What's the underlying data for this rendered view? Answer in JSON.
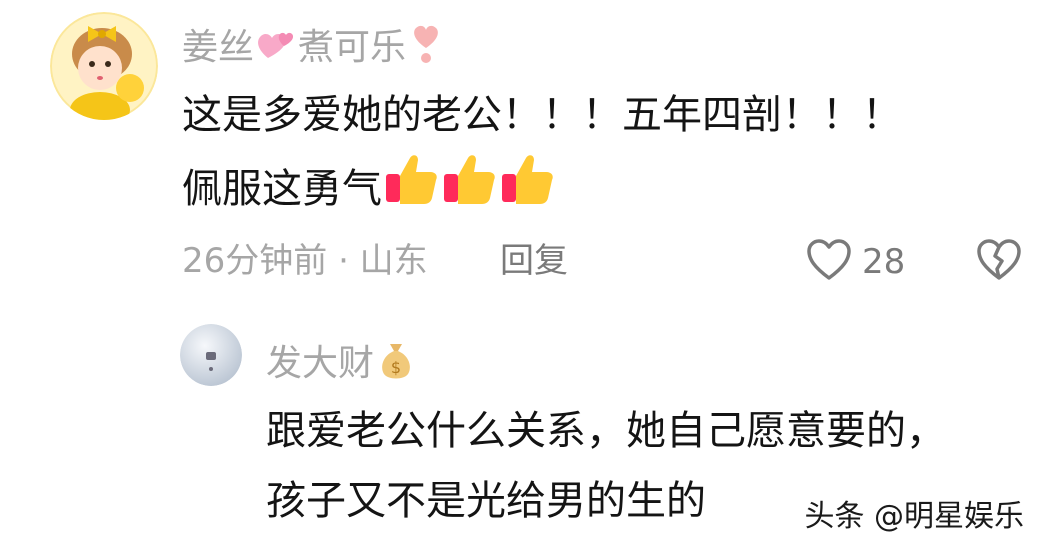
{
  "comments": [
    {
      "username": "姜丝",
      "username_suffix": "煮可乐",
      "username_emojis": [
        "two-hearts-icon",
        "heart-exclamation-icon"
      ],
      "text_line1": "这是多爱她的老公！！！五年四剖！！！",
      "text_line2": "佩服这勇气",
      "text_emojis": [
        "thumbs-up-icon",
        "thumbs-up-icon",
        "thumbs-up-icon"
      ],
      "time_location": "26分钟前 · 山东",
      "reply_label": "回复",
      "like_count": "28"
    }
  ],
  "reply": {
    "username": "发大财",
    "username_emoji": "money-bag-icon",
    "text_line1": "跟爱老公什么关系，她自己愿意要的，",
    "text_line2": "孩子又不是光给男的生的"
  },
  "watermark": "头条 @明星娱乐",
  "colors": {
    "username": "#a6a6a6",
    "body_text": "#141414",
    "meta": "#a6a6a6",
    "action": "#7a7a7a",
    "background": "#ffffff"
  }
}
